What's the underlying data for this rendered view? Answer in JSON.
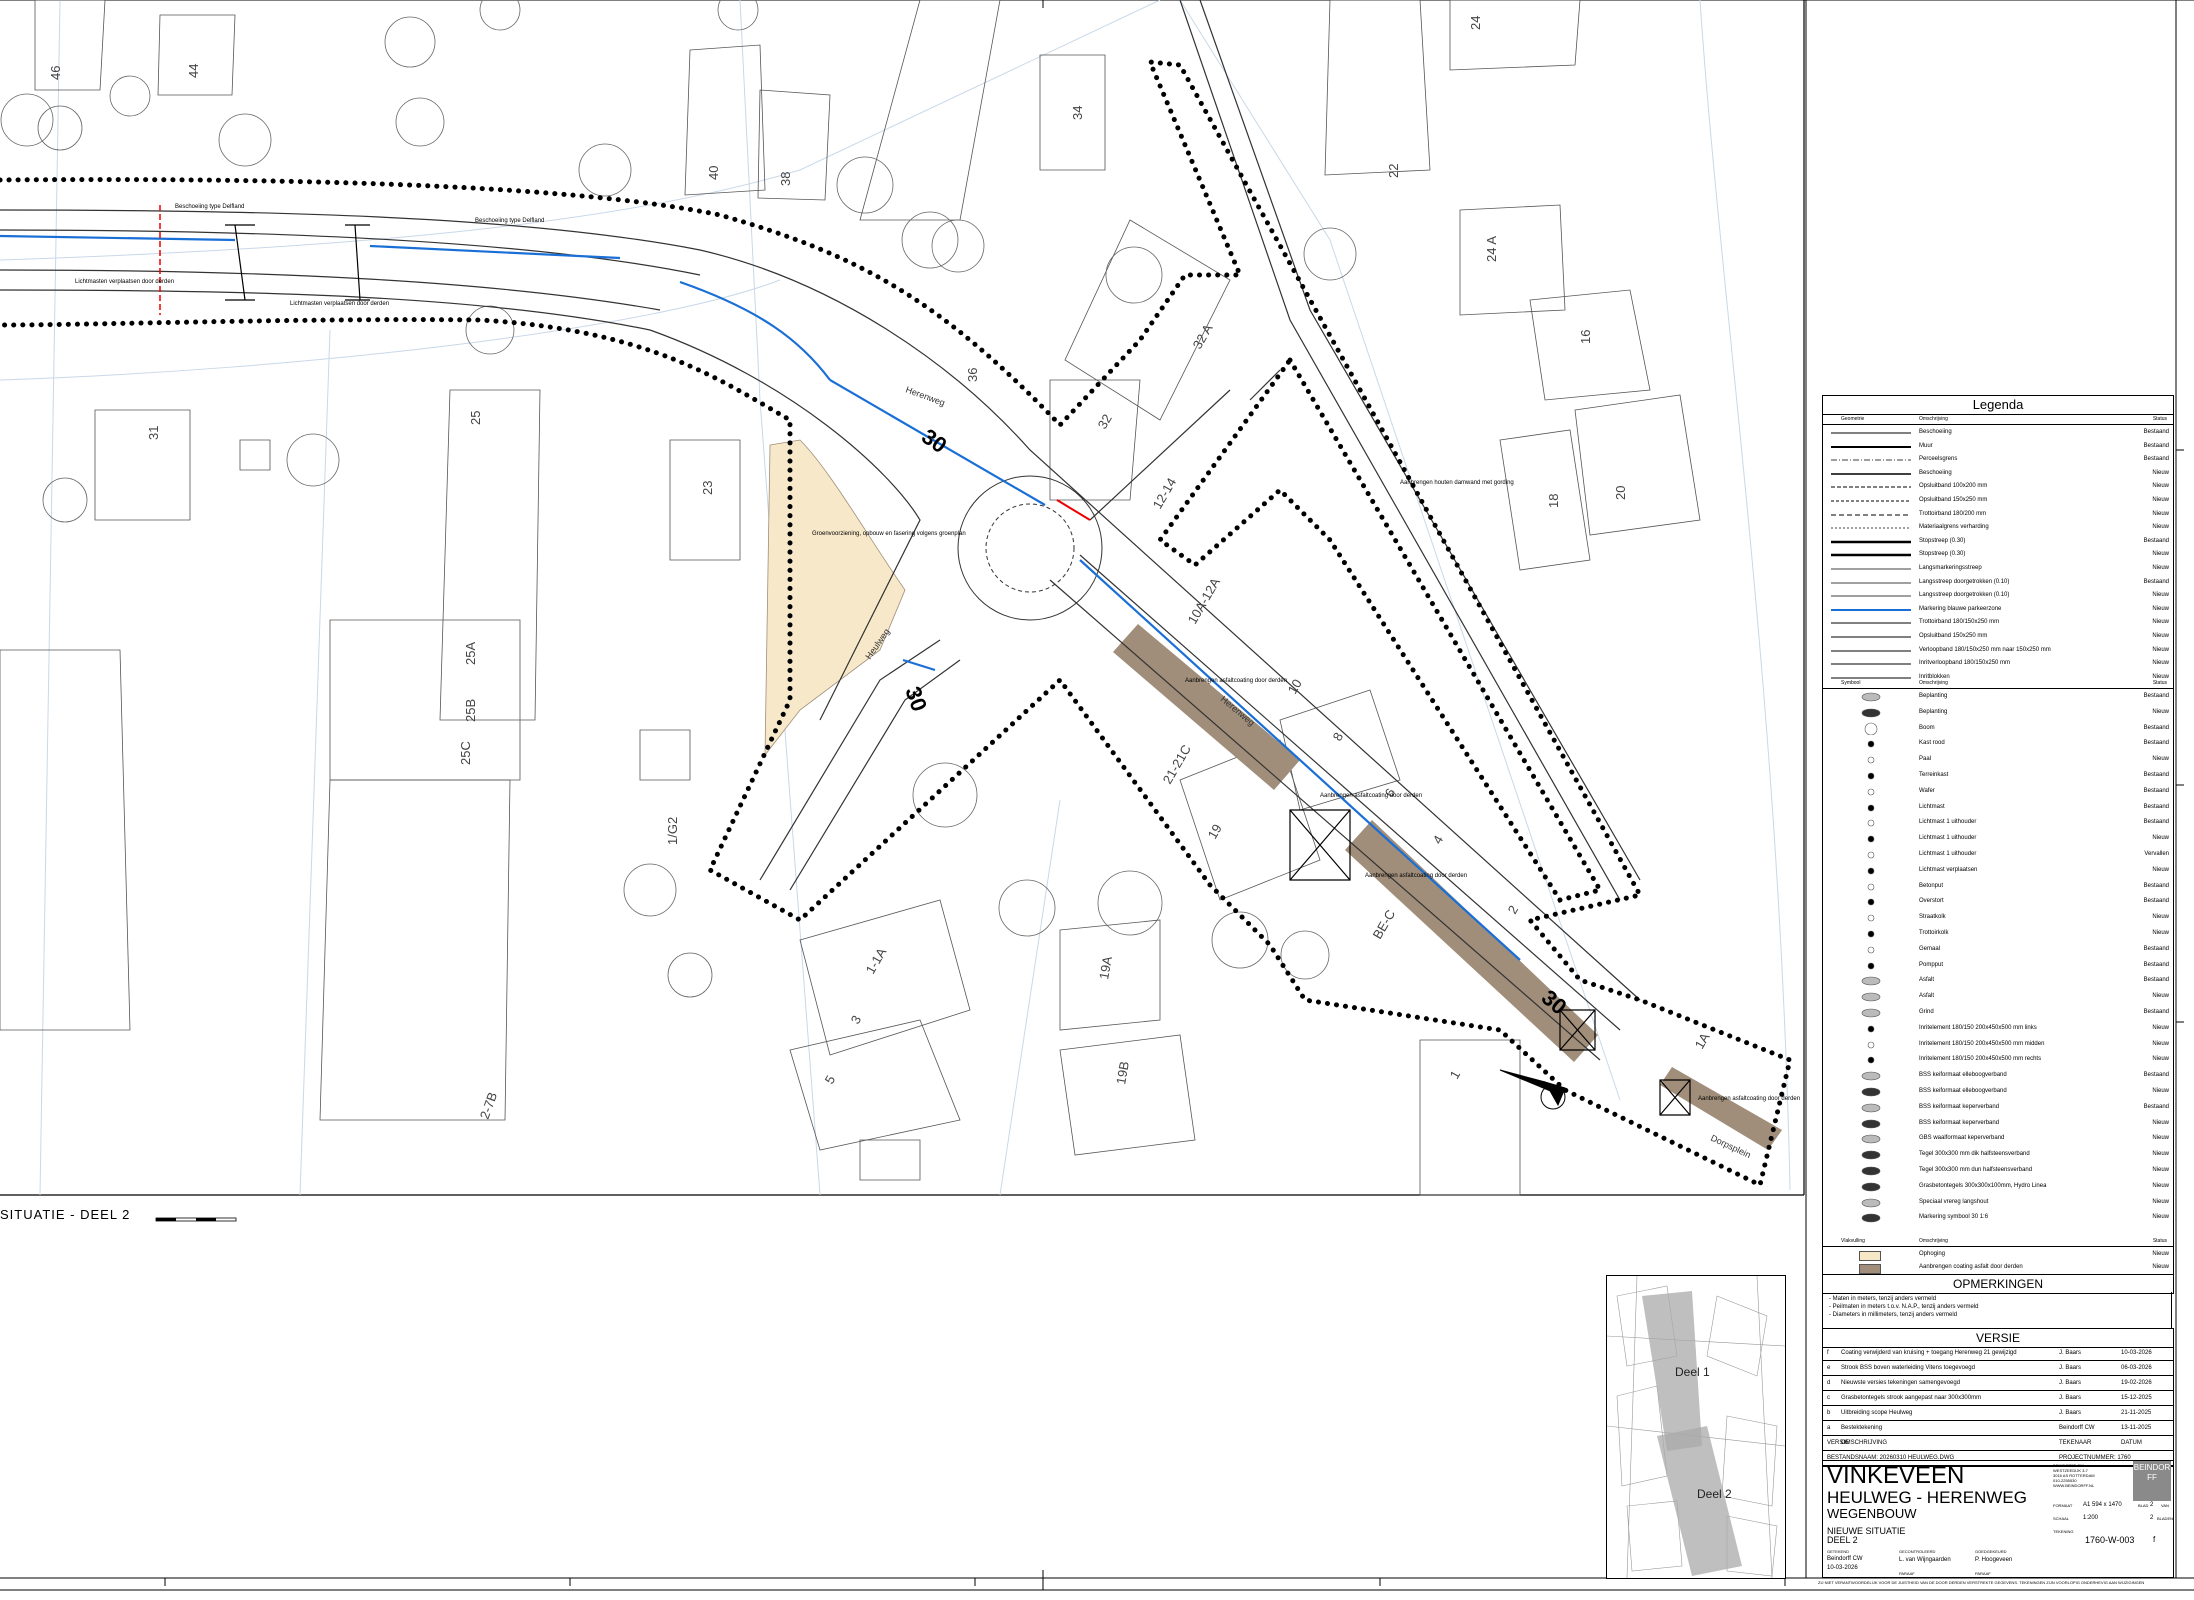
{
  "map": {
    "section_caption": "SITUATIE - DEEL 2",
    "street_labels": [
      "Herenweg",
      "Heulweg",
      "Herenweg",
      "Dorpsplein"
    ],
    "annotations": [
      "Aanbrengen houten damwand met gording",
      "Aanbrengen asfaltcoating door derden",
      "Aanbrengen asfaltcoating door derden",
      "Aanbrengen asfaltcoating door derden",
      "Aanbrengen asfaltcoating door derden",
      "Groenvoorziening, opbouw en fasering volgens groenplan",
      "Lichtmasten verplaatsen door derden",
      "Beschoeiing type Delfland",
      "Beschoeiing type Delfland",
      "Lichtmasten verplaatsen door derden"
    ],
    "house_numbers": [
      "46",
      "44",
      "40",
      "38",
      "34",
      "24",
      "22",
      "24 A",
      "16",
      "18",
      "20",
      "31",
      "25",
      "23",
      "36",
      "32",
      "32 A",
      "12-14",
      "10A-12A",
      "10",
      "8",
      "6",
      "4",
      "2",
      "25A",
      "25B",
      "25C",
      "1/G2",
      "21-21C",
      "19",
      "1-1A",
      "3",
      "5",
      "19A",
      "19B",
      "2-7B",
      "1",
      "BE-C",
      "1A"
    ],
    "speed_markings": [
      "30",
      "30",
      "30"
    ],
    "keymap_labels": [
      "Deel 1",
      "Deel 2"
    ]
  },
  "legend": {
    "title": "Legenda",
    "header1": {
      "col1": "Geometrie",
      "col2": "Omschrijving",
      "col3": "Status"
    },
    "lines": [
      {
        "desc": "Beschoeiing",
        "status": "Bestaand"
      },
      {
        "desc": "Muur",
        "status": "Bestaand"
      },
      {
        "desc": "Perceelsgrens",
        "status": "Bestaand"
      },
      {
        "desc": "Beschoeiing",
        "status": "Nieuw"
      },
      {
        "desc": "Opsluitband 100x200 mm",
        "status": "Nieuw"
      },
      {
        "desc": "Opsluitband 150x250 mm",
        "status": "Nieuw"
      },
      {
        "desc": "Trottoirband 180/200 mm",
        "status": "Nieuw"
      },
      {
        "desc": "Materiaalgrens verharding",
        "status": "Nieuw"
      },
      {
        "desc": "Stopstreep (0.30)",
        "status": "Bestaand"
      },
      {
        "desc": "Stopstreep (0.30)",
        "status": "Nieuw"
      },
      {
        "desc": "Langsmarkeringsstreep",
        "status": "Nieuw"
      },
      {
        "desc": "Langsstreep doorgetrokken (0.10)",
        "status": "Bestaand"
      },
      {
        "desc": "Langsstreep doorgetrokken (0.10)",
        "status": "Nieuw"
      },
      {
        "desc": "Markering blauwe parkeerzone",
        "status": "Nieuw"
      },
      {
        "desc": "Trottoirband 180/150x250 mm",
        "status": "Nieuw"
      },
      {
        "desc": "Opsluitband 150x250 mm",
        "status": "Nieuw"
      },
      {
        "desc": "Verloopband 180/150x250 mm naar 150x250 mm",
        "status": "Nieuw"
      },
      {
        "desc": "Inritverloopband 180/150x250 mm",
        "status": "Nieuw"
      },
      {
        "desc": "Inritblokken",
        "status": "Nieuw"
      }
    ],
    "header2": {
      "col1": "Symbool",
      "col2": "Omschrijving",
      "col3": "Status"
    },
    "symbols": [
      {
        "desc": "Beplanting",
        "status": "Bestaand"
      },
      {
        "desc": "Beplanting",
        "status": "Nieuw"
      },
      {
        "desc": "Boom",
        "status": "Bestaand"
      },
      {
        "desc": "Kast rood",
        "status": "Bestaand"
      },
      {
        "desc": "Paal",
        "status": "Nieuw"
      },
      {
        "desc": "Terreinkast",
        "status": "Bestaand"
      },
      {
        "desc": "Wafer",
        "status": "Bestaand"
      },
      {
        "desc": "Lichtmast",
        "status": "Bestaand"
      },
      {
        "desc": "Lichtmast 1 uithouder",
        "status": "Bestaand"
      },
      {
        "desc": "Lichtmast 1 uithouder",
        "status": "Nieuw"
      },
      {
        "desc": "Lichtmast 1 uithouder",
        "status": "Vervallen"
      },
      {
        "desc": "Lichtmast verplaatsen",
        "status": "Nieuw"
      },
      {
        "desc": "Betonput",
        "status": "Bestaand"
      },
      {
        "desc": "Overstort",
        "status": "Bestaand"
      },
      {
        "desc": "Straatkolk",
        "status": "Nieuw"
      },
      {
        "desc": "Trottoirkolk",
        "status": "Nieuw"
      },
      {
        "desc": "Gemaal",
        "status": "Bestaand"
      },
      {
        "desc": "Pompput",
        "status": "Bestaand"
      },
      {
        "desc": "Asfalt",
        "status": "Bestaand"
      },
      {
        "desc": "Asfalt",
        "status": "Nieuw"
      },
      {
        "desc": "Grind",
        "status": "Bestaand"
      },
      {
        "desc": "Inritelement 180/150 200x450x500 mm links",
        "status": "Nieuw"
      },
      {
        "desc": "Inritelement 180/150 200x450x500 mm midden",
        "status": "Nieuw"
      },
      {
        "desc": "Inritelement 180/150 200x450x500 mm rechts",
        "status": "Nieuw"
      },
      {
        "desc": "BSS keiformaat elleboogverband",
        "status": "Bestaand"
      },
      {
        "desc": "BSS keiformaat elleboogverband",
        "status": "Nieuw"
      },
      {
        "desc": "BSS keiformaat keperverband",
        "status": "Bestaand"
      },
      {
        "desc": "BSS keiformaat keperverband",
        "status": "Nieuw"
      },
      {
        "desc": "GBS waalformaat keperverband",
        "status": "Nieuw"
      },
      {
        "desc": "Tegel 300x300 mm dik halfsteensverband",
        "status": "Nieuw"
      },
      {
        "desc": "Tegel 300x300 mm dun halfsteensverband",
        "status": "Nieuw"
      },
      {
        "desc": "Grasbetontegels 300x300x100mm, Hydro Linea",
        "status": "Nieuw"
      },
      {
        "desc": "Speciaal vrereg langshout",
        "status": "Nieuw"
      },
      {
        "desc": "Markering symbool 30 1:6",
        "status": "Nieuw"
      }
    ],
    "header3": {
      "col1": "Vlakvulling",
      "col2": "Omschrijving",
      "col3": "Status"
    },
    "fills": [
      {
        "desc": "Ophoging",
        "status": "Nieuw",
        "color": "#f7e8c8"
      },
      {
        "desc": "Aanbrengen coating asfalt door derden",
        "status": "Nieuw",
        "color": "#a08e7a"
      }
    ]
  },
  "remarks": {
    "title": "OPMERKINGEN",
    "lines": [
      "- Maten in meters, tenzij anders vermeld",
      "- Peilmaten in meters t.o.v. N.A.P., tenzij anders vermeld",
      "- Diameters in millimeters, tenzij anders vermeld"
    ]
  },
  "versions": {
    "title": "VERSIE",
    "rows": [
      {
        "v": "f",
        "desc": "Coating verwijderd van kruising + toegang Herenweg 21 gewijzigd",
        "by": "J. Baars",
        "date": "10-03-2026"
      },
      {
        "v": "e",
        "desc": "Strook BSS boven waterleiding Vitens toegevoegd",
        "by": "J. Baars",
        "date": "06-03-2026"
      },
      {
        "v": "d",
        "desc": "Nieuwste versies tekeningen samengevoegd",
        "by": "J. Baars",
        "date": "19-02-2026"
      },
      {
        "v": "c",
        "desc": "Grasbetontegels strook aangepast naar 300x300mm",
        "by": "J. Baars",
        "date": "15-12-2025"
      },
      {
        "v": "b",
        "desc": "Uitbreiding scope Heulweg",
        "by": "J. Baars",
        "date": "21-11-2025"
      },
      {
        "v": "a",
        "desc": "Bestektekening",
        "by": "Beindorff CW",
        "date": "13-11-2025"
      }
    ],
    "footer": {
      "v": "VERSIE",
      "desc": "OMSCHRIJVING",
      "by": "TEKENAAR",
      "date": "DATUM"
    },
    "drawing_name_label": "BESTANDSNAAM: 20260310 HEULWEG.DWG",
    "project_number_label": "PROJECTNUMMER: 1760"
  },
  "title_block": {
    "place": "VINKEVEEN",
    "project": "HEULWEG - HERENWEG",
    "discipline": "WEGENBOUW",
    "sheet_title1": "NIEUWE SITUATIE",
    "sheet_title2": "DEEL 2",
    "company_lines": [
      "BEINDORFF CW",
      "WESTZEEDIJK 3-7",
      "3016 AS ROTTERDAM",
      "010-2255530",
      "WWW.BEINDORFF.NL"
    ],
    "format_label": "FORMAAT",
    "format_value": "A1 594 x 1470",
    "sheet_label": "BLAD",
    "sheet_value": "2",
    "of_label": "VAN",
    "scale_label": "SCHAAL",
    "scale_value": "1:200",
    "of_value": "2",
    "sheets_label": "BLADEN",
    "drawing_no_label": "TEKENING",
    "drawing_no": "1760-W-003",
    "revision": "f",
    "drawn_label": "GETEKEND",
    "drawn_by": "Beindorff CW",
    "drawn_date": "10-03-2026",
    "checked_label": "GECONTROLEERD",
    "checked_by": "L. van Wijngaarden",
    "approved_label": "GOEDGEKEURD",
    "approved_by": "P. Hoogeveen",
    "paraaf_label": "PARAAF",
    "logo_letters": "BEINDORFF",
    "footer_note": "ZIJ NIET VERANTWOORDELIJK VOOR DE JUISTHEID VAN DE DOOR DERDEN VERSTREKTE GEGEVENS. TEKENINGEN ZIJN VOORLOPIG ONDERHEVIG AAN WIJZIGINGEN"
  }
}
